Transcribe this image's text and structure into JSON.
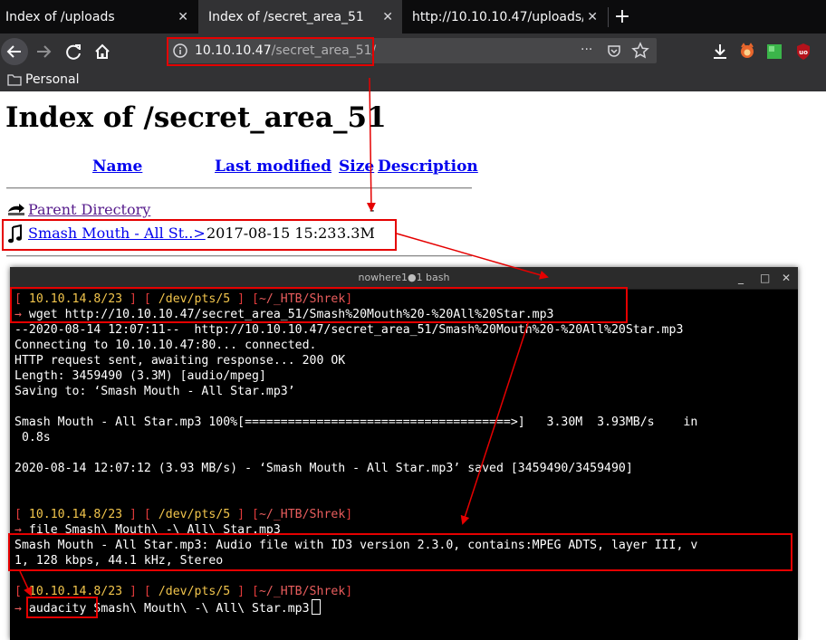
{
  "browser": {
    "tabs": [
      {
        "title": "Index of /uploads",
        "close_symbol": "✕",
        "active": false
      },
      {
        "title": "Index of /secret_area_51",
        "close_symbol": "✕",
        "active": true
      },
      {
        "title": "http://10.10.10.47/uploads/s",
        "close_symbol": "✕",
        "active": false
      }
    ],
    "new_tab_symbol": "+",
    "url_host": "10.10.10.47",
    "url_path": "/secret_area_51/",
    "page_actions_symbol": "···",
    "bookmark_folder": "Personal",
    "toolbar_icons": [
      "back-icon",
      "forward-icon",
      "reload-icon",
      "home-icon",
      "info-icon",
      "pocket-icon",
      "bookmark-star-icon",
      "download-icon",
      "fox-extension-icon",
      "green-extension-icon",
      "ublock-icon",
      "hamburger-menu-icon"
    ]
  },
  "page": {
    "title": "Index of /secret_area_51",
    "columns": {
      "name": "Name",
      "last_modified": "Last modified",
      "size": "Size",
      "description": "Description"
    },
    "parent": {
      "name": "Parent Directory",
      "size": "-"
    },
    "file": {
      "name": "Smash Mouth - All St..>",
      "last_modified": "2017-08-15 15:23",
      "size": "3.3M"
    }
  },
  "terminal": {
    "window_title": "nowhere1●1 bash",
    "window_buttons": [
      "_",
      "□",
      "✕"
    ],
    "prompt": {
      "host": "10.10.14.8/23",
      "tty": "/dev/pts/5",
      "cwd": "~/_HTB/Shrek"
    },
    "lines": [
      "→ wget http://10.10.10.47/secret_area_51/Smash%20Mouth%20-%20All%20Star.mp3",
      "--2020-08-14 12:07:11--  http://10.10.10.47/secret_area_51/Smash%20Mouth%20-%20All%20Star.mp3",
      "Connecting to 10.10.10.47:80... connected.",
      "HTTP request sent, awaiting response... 200 OK",
      "Length: 3459490 (3.3M) [audio/mpeg]",
      "Saving to: ‘Smash Mouth - All Star.mp3’",
      "",
      "Smash Mouth - All Star.mp3 100%[=====================================>]   3.30M  3.93MB/s    in",
      " 0.8s",
      "",
      "2020-08-14 12:07:12 (3.93 MB/s) - ‘Smash Mouth - All Star.mp3’ saved [3459490/3459490]",
      "",
      "",
      "PROMPT",
      "→ file Smash\\ Mouth\\ -\\ All\\ Star.mp3",
      "Smash Mouth - All Star.mp3: Audio file with ID3 version 2.3.0, contains:MPEG ADTS, layer III, v",
      "1, 128 kbps, 44.1 kHz, Stereo",
      "",
      "PROMPT"
    ],
    "last_command": {
      "arrow": "→",
      "cmd": "audacity",
      "args": " Smash\\ Mouth\\ -\\ All\\ Star.mp3"
    }
  },
  "annotation_color": "#e50000"
}
